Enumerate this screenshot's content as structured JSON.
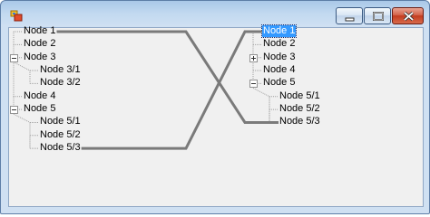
{
  "window": {
    "title": ""
  },
  "left_tree": {
    "nodes": [
      {
        "label": "Node 1",
        "indent": 0,
        "expander": "none"
      },
      {
        "label": "Node 2",
        "indent": 0,
        "expander": "none"
      },
      {
        "label": "Node 3",
        "indent": 0,
        "expander": "collapse"
      },
      {
        "label": "Node 3/1",
        "indent": 1,
        "expander": "none"
      },
      {
        "label": "Node 3/2",
        "indent": 1,
        "expander": "none"
      },
      {
        "label": "Node 4",
        "indent": 0,
        "expander": "none"
      },
      {
        "label": "Node 5",
        "indent": 0,
        "expander": "collapse"
      },
      {
        "label": "Node 5/1",
        "indent": 1,
        "expander": "none"
      },
      {
        "label": "Node 5/2",
        "indent": 1,
        "expander": "none"
      },
      {
        "label": "Node 5/3",
        "indent": 1,
        "expander": "none"
      }
    ]
  },
  "right_tree": {
    "nodes": [
      {
        "label": "Node 1",
        "indent": 0,
        "expander": "none",
        "selected": true
      },
      {
        "label": "Node 2",
        "indent": 0,
        "expander": "none"
      },
      {
        "label": "Node 3",
        "indent": 0,
        "expander": "expand"
      },
      {
        "label": "Node 4",
        "indent": 0,
        "expander": "none"
      },
      {
        "label": "Node 5",
        "indent": 0,
        "expander": "collapse"
      },
      {
        "label": "Node 5/1",
        "indent": 1,
        "expander": "none"
      },
      {
        "label": "Node 5/2",
        "indent": 1,
        "expander": "none"
      },
      {
        "label": "Node 5/3",
        "indent": 1,
        "expander": "none"
      }
    ]
  },
  "connections": [
    {
      "from": "Node 1",
      "to": "Node 5/3"
    },
    {
      "from": "Node 5/3",
      "to": "Node 1"
    }
  ],
  "colors": {
    "selection": "#3399ff",
    "connector": "#7a7a7a",
    "tree_line": "#a0a0a0"
  }
}
